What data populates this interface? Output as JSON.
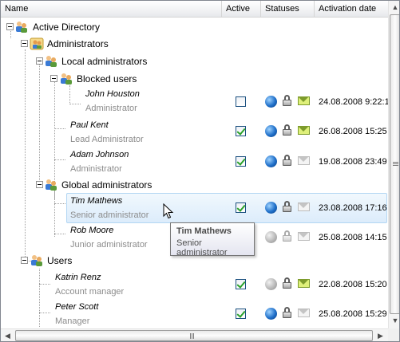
{
  "columns": {
    "name": "Name",
    "active": "Active",
    "statuses": "Statuses",
    "activation_date": "Activation date"
  },
  "tree": {
    "root": "Active Directory",
    "administrators": "Administrators",
    "local_administrators": "Local administrators",
    "blocked_users": "Blocked users",
    "global_administrators": "Global administrators",
    "users": "Users"
  },
  "rows": [
    {
      "name": "John Houston",
      "role": "Administrator",
      "active": false,
      "globe": "blue",
      "lock": "dark",
      "mail": "green",
      "date": "24.08.2008 9:22:1"
    },
    {
      "name": "Paul Kent",
      "role": "Lead Administrator",
      "active": true,
      "globe": "blue",
      "lock": "dark",
      "mail": "green",
      "date": "26.08.2008 15:25"
    },
    {
      "name": "Adam Johnson",
      "role": "Administrator",
      "active": true,
      "globe": "blue",
      "lock": "dark",
      "mail": "gray",
      "date": "19.08.2008 23:49"
    },
    {
      "name": "Tim Mathews",
      "role": "Senior administrator",
      "active": true,
      "globe": "blue",
      "lock": "dark",
      "mail": "gray",
      "date": "23.08.2008 17:16"
    },
    {
      "name": "Rob Moore",
      "role": "Junior administrator",
      "active": true,
      "globe": "gray",
      "lock": "gray",
      "mail": "gray",
      "date": "25.08.2008 14:15"
    },
    {
      "name": "Katrin Renz",
      "role": "Account manager",
      "active": true,
      "globe": "gray",
      "lock": "dark",
      "mail": "green",
      "date": "22.08.2008 15:20"
    },
    {
      "name": "Peter Scott",
      "role": "Manager",
      "active": true,
      "globe": "blue",
      "lock": "dark",
      "mail": "gray",
      "date": "25.08.2008 15:29"
    }
  ],
  "tooltip": {
    "title": "Tim Mathews",
    "body": "Senior administrator"
  },
  "colors": {
    "selection": "#dcecfb",
    "selection_border": "#b3d6f3",
    "role_text": "#8c8c8c",
    "check_mark": "#2aa22a"
  },
  "icons": {
    "group": "users-group-icon",
    "globe": "globe-icon",
    "lock": "lock-icon",
    "mail": "envelope-icon",
    "cursor": "mouse-pointer-icon"
  }
}
